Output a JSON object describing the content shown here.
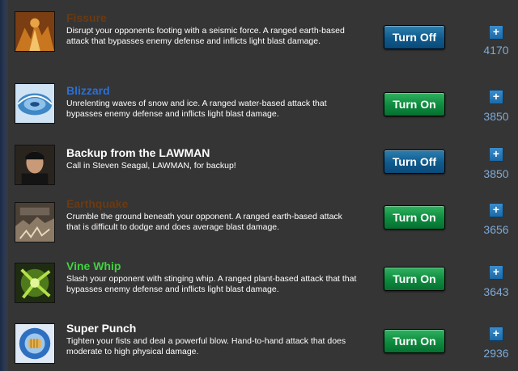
{
  "abilities": [
    {
      "title": "Fissure",
      "title_color": "#6b3a12",
      "description": "Disrupt your opponents footing with a seismic force. A ranged earth-based attack that bypasses enemy defense and inflicts light blast damage.",
      "button_label": "Turn Off",
      "button_state": "off",
      "count": "4170",
      "icon": "fissure-icon"
    },
    {
      "title": "Blizzard",
      "title_color": "#2b6fd6",
      "description": "Unrelenting waves of snow and ice. A ranged water-based attack that bypasses enemy defense and inflicts light blast damage.",
      "button_label": "Turn On",
      "button_state": "on",
      "count": "3850",
      "icon": "blizzard-icon"
    },
    {
      "title": "Backup from the LAWMAN",
      "title_color": "#ffffff",
      "description": "Call in Steven Seagal, LAWMAN, for backup!",
      "button_label": "Turn Off",
      "button_state": "off",
      "count": "3850",
      "icon": "lawman-portrait-icon"
    },
    {
      "title": "Earthquake",
      "title_color": "#6b3a12",
      "description": "Crumble the ground beneath your opponent. A ranged earth-based attack that is difficult to dodge and does average blast damage.",
      "button_label": "Turn On",
      "button_state": "on",
      "count": "3656",
      "icon": "earthquake-icon"
    },
    {
      "title": "Vine Whip",
      "title_color": "#3fd13f",
      "description": "Slash your opponent with stinging whip. A ranged plant-based attack that that bypasses enemy defense and inflicts light blast damage.",
      "button_label": "Turn On",
      "button_state": "on",
      "count": "3643",
      "icon": "vine-whip-icon"
    },
    {
      "title": "Super Punch",
      "title_color": "#ffffff",
      "description": "Tighten your fists and deal a powerful blow. Hand-to-hand attack that does moderate to high physical damage.",
      "button_label": "Turn On",
      "button_state": "on",
      "count": "2936",
      "icon": "super-punch-icon"
    }
  ],
  "plus_label": "+"
}
